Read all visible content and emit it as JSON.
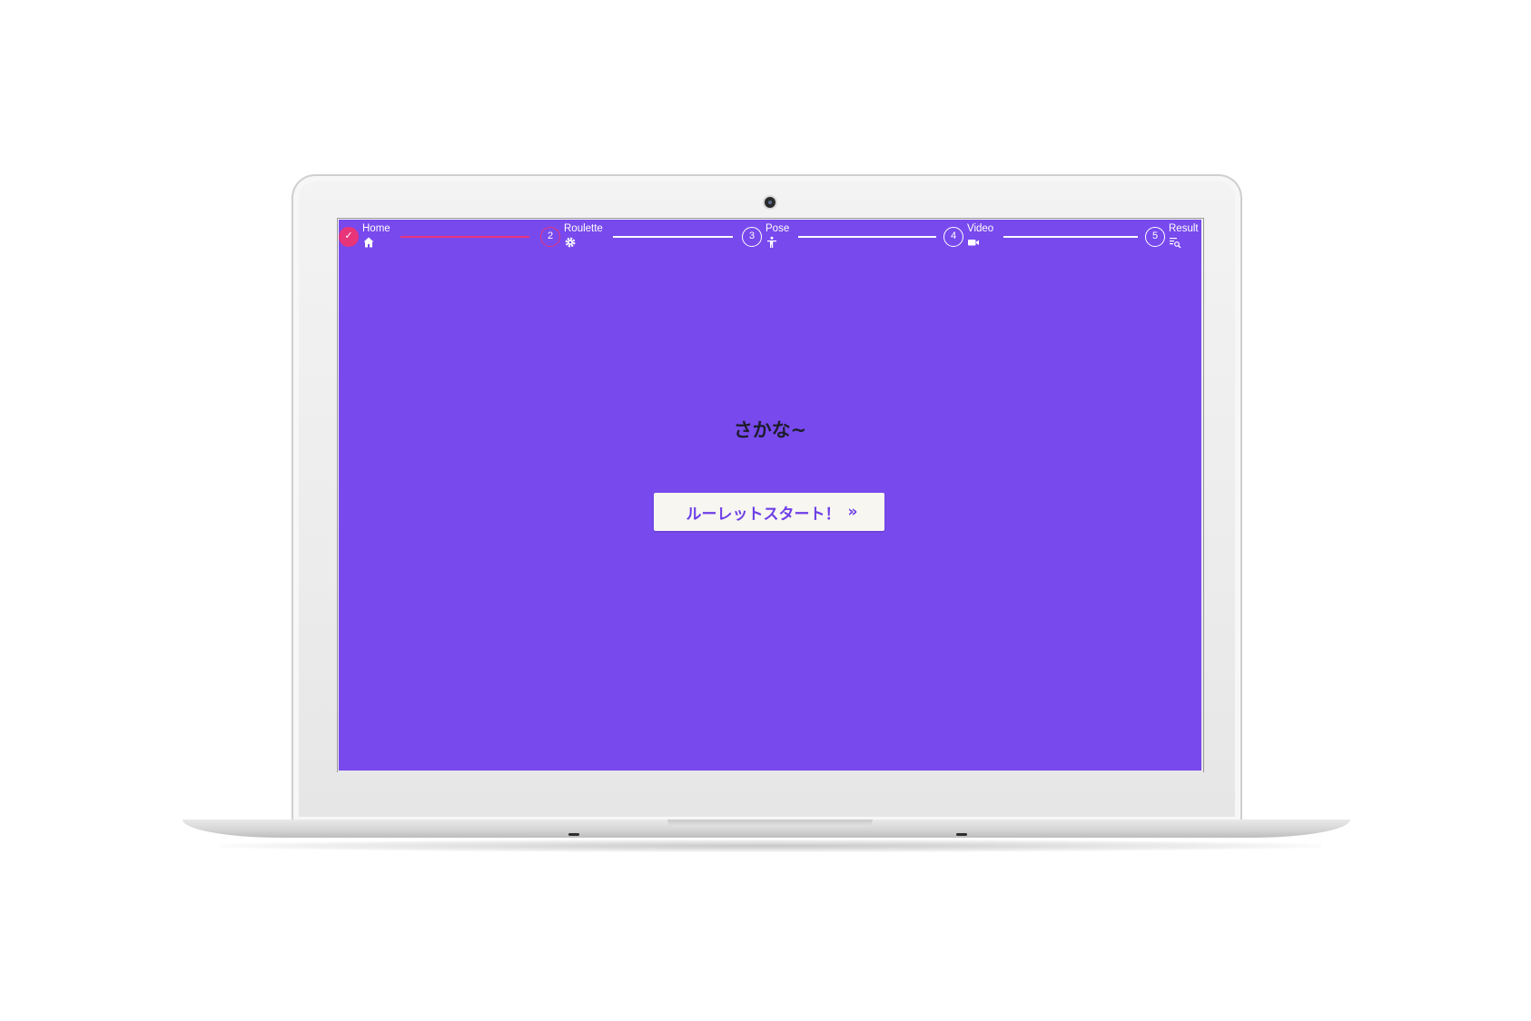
{
  "stepper": {
    "steps": [
      {
        "label": "Home",
        "number": "",
        "state": "done",
        "icon": "home-icon"
      },
      {
        "label": "Roulette",
        "number": "2",
        "state": "active",
        "icon": "gear-icon"
      },
      {
        "label": "Pose",
        "number": "3",
        "state": "pending",
        "icon": "person-pose-icon"
      },
      {
        "label": "Video",
        "number": "4",
        "state": "pending",
        "icon": "video-camera-icon"
      },
      {
        "label": "Result",
        "number": "5",
        "state": "pending",
        "icon": "list-search-icon"
      }
    ],
    "done_check": "✓"
  },
  "main": {
    "subtitle": "さかな~",
    "start_button_label": "ルーレットスタート！",
    "start_button_icon": "double-chevron-right-icon",
    "start_button_glyph": "»"
  },
  "colors": {
    "background": "#7849ed",
    "accent": "#e8357a",
    "button_bg": "#f7f6f1",
    "button_text": "#6d3fe6"
  }
}
